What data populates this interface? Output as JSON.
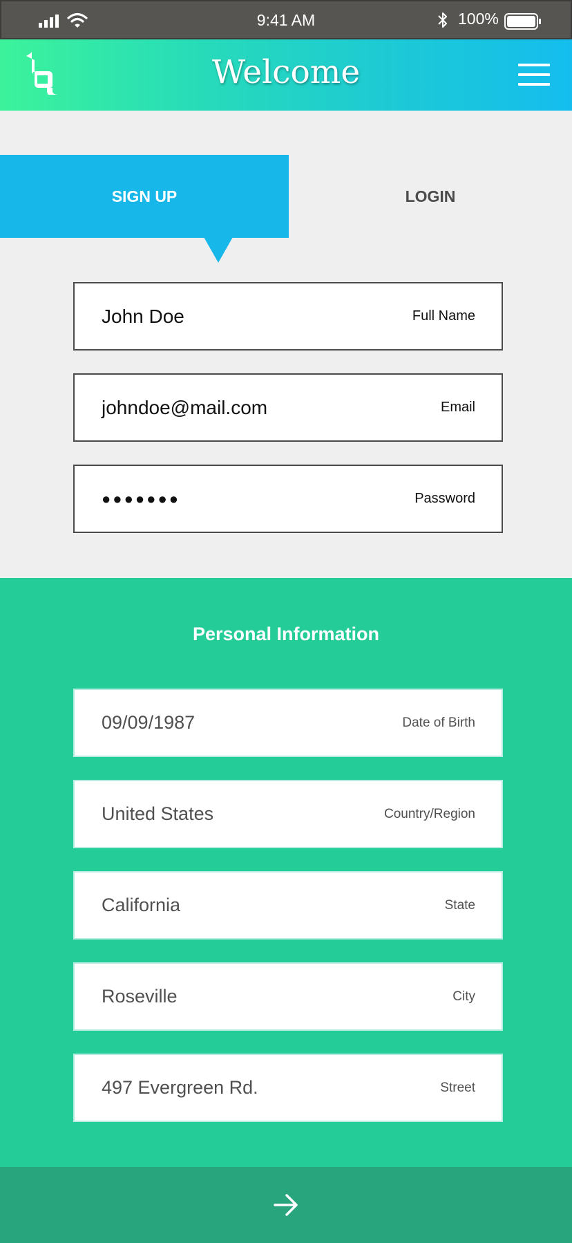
{
  "status_bar": {
    "time": "9:41 AM",
    "battery_percent": "100%",
    "icons": [
      "signal-icon",
      "wifi-icon",
      "bluetooth-icon",
      "battery-icon"
    ]
  },
  "header": {
    "title": "Welcome",
    "logo_icon": "brand-logo-icon",
    "menu_icon": "hamburger-menu-icon"
  },
  "tabs": {
    "active": "signup",
    "signup_label": "SIGN UP",
    "login_label": "LOGIN"
  },
  "account": {
    "full_name": {
      "value": "John Doe",
      "label": "Full Name"
    },
    "email": {
      "value": "johndoe@mail.com",
      "label": "Email"
    },
    "password": {
      "value": "●●●●●●●",
      "label": "Password"
    }
  },
  "personal": {
    "title": "Personal Information",
    "dob": {
      "value": "09/09/1987",
      "label": "Date of Birth"
    },
    "country": {
      "value": "United States",
      "label": "Country/Region"
    },
    "state": {
      "value": "California",
      "label": "State"
    },
    "city": {
      "value": "Roseville",
      "label": "City"
    },
    "street": {
      "value": "497 Evergreen Rd.",
      "label": "Street"
    }
  },
  "footer": {
    "next_icon": "arrow-right-icon"
  },
  "colors": {
    "status_bar": "#575551",
    "header_gradient_start": "#3cf39b",
    "header_gradient_end": "#14bdee",
    "tab_active": "#17b7ea",
    "page_bg": "#efefef",
    "personal_bg": "#24cc97",
    "footer_bg": "#29a57d"
  }
}
